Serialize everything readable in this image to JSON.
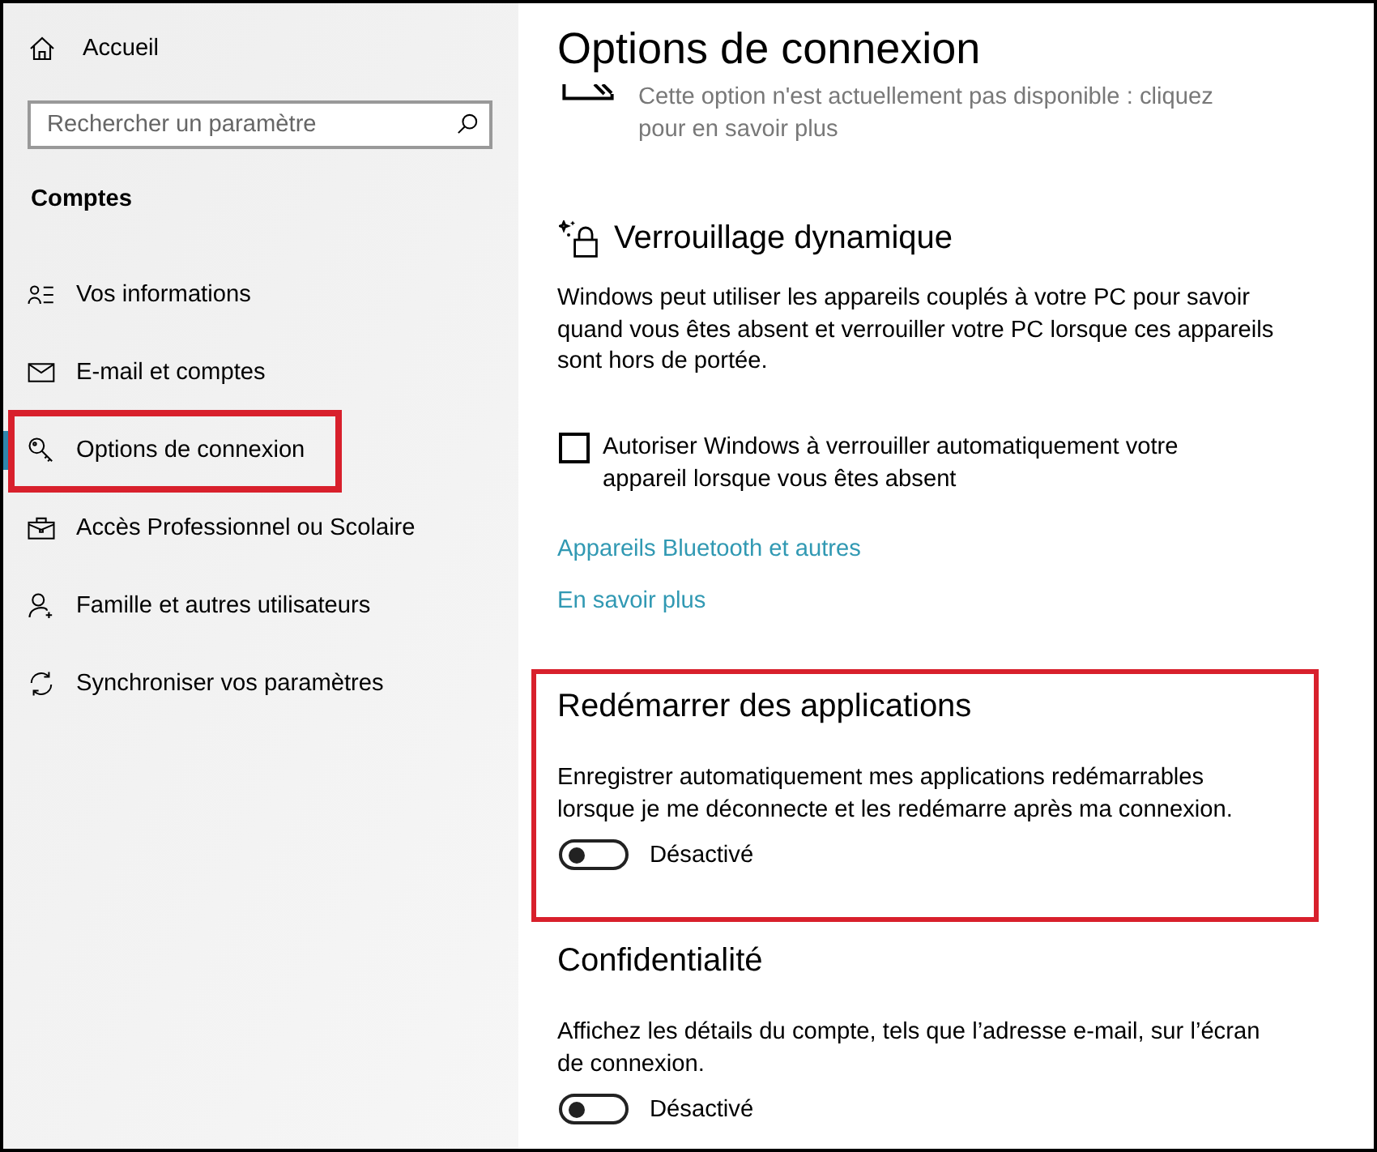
{
  "sidebar": {
    "home": {
      "label": "Accueil"
    },
    "search": {
      "placeholder": "Rechercher un paramètre"
    },
    "heading": "Comptes",
    "items": [
      {
        "label": "Vos informations",
        "selected": false,
        "highlighted": false
      },
      {
        "label": "E-mail et comptes",
        "selected": false,
        "highlighted": false
      },
      {
        "label": "Options de connexion",
        "selected": true,
        "highlighted": true
      },
      {
        "label": "Accès Professionnel ou Scolaire",
        "selected": false,
        "highlighted": false
      },
      {
        "label": "Famille et autres utilisateurs",
        "selected": false,
        "highlighted": false
      },
      {
        "label": "Synchroniser vos paramètres",
        "selected": false,
        "highlighted": false
      }
    ]
  },
  "page": {
    "title": "Options de connexion",
    "notice": {
      "text": "Cette option n'est actuellement pas disponible : cliquez pour en savoir plus",
      "disabled": true
    },
    "sections": [
      {
        "kind": "icon-heading",
        "heading": "Verrouillage dynamique",
        "highlighted": false,
        "text": "Windows peut utiliser les appareils couplés à votre PC pour savoir quand vous êtes absent et verrouiller votre PC lorsque ces appareils sont hors de portée.",
        "checkbox": {
          "label": "Autoriser Windows à verrouiller automatiquement votre appareil lorsque vous êtes absent",
          "checked": false
        },
        "links": [
          "Appareils Bluetooth et autres",
          "En savoir plus"
        ]
      },
      {
        "kind": "plain-heading",
        "heading": "Redémarrer des applications",
        "highlighted": true,
        "text": "Enregistrer automatiquement mes applications redémarrables lorsque je me déconnecte et les redémarre après ma connexion.",
        "toggle": {
          "label": "Désactivé",
          "on": false
        }
      },
      {
        "kind": "plain-heading",
        "heading": "Confidentialité",
        "highlighted": false,
        "text": "Affichez les détails du compte, tels que l’adresse e-mail, sur l’écran de connexion.",
        "toggle": {
          "label": "Désactivé",
          "on": false
        }
      }
    ]
  }
}
